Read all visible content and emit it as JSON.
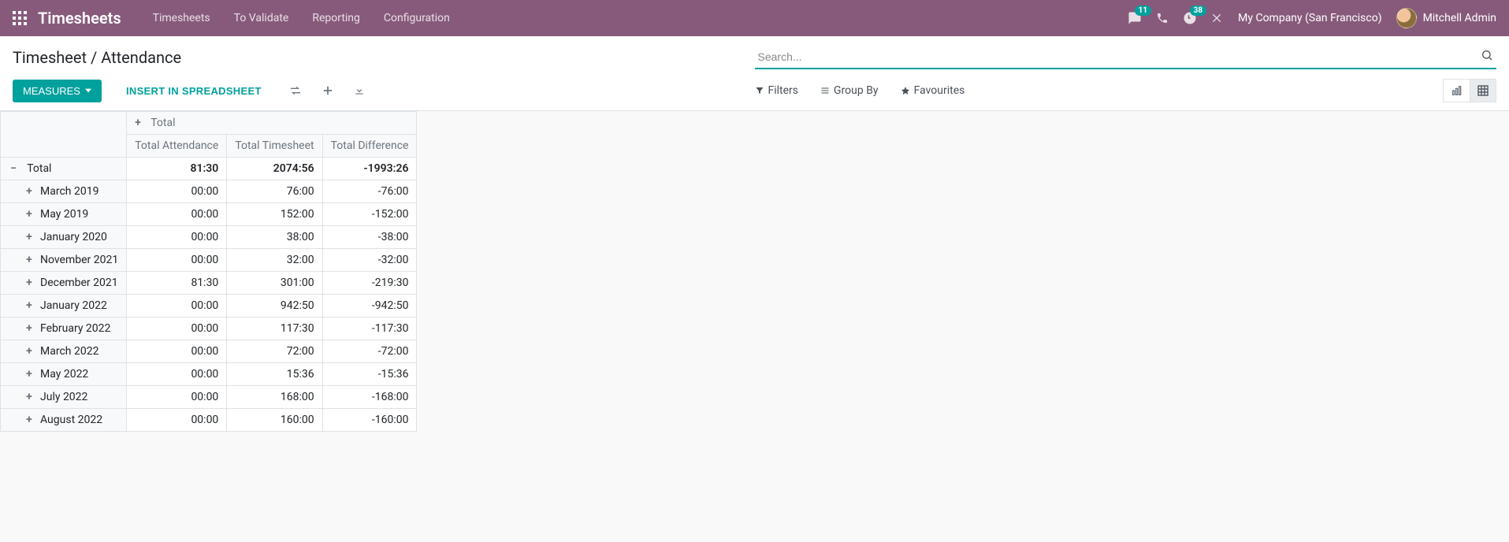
{
  "nav": {
    "brand": "Timesheets",
    "menu": [
      "Timesheets",
      "To Validate",
      "Reporting",
      "Configuration"
    ],
    "messages_badge": "11",
    "activities_badge": "38",
    "company": "My Company (San Francisco)",
    "user": "Mitchell Admin"
  },
  "breadcrumb": "Timesheet / Attendance",
  "search": {
    "placeholder": "Search..."
  },
  "buttons": {
    "measures": "MEASURES",
    "insert_spreadsheet": "INSERT IN SPREADSHEET"
  },
  "search_opts": {
    "filters": "Filters",
    "group_by": "Group By",
    "favourites": "Favourites"
  },
  "pivot": {
    "col_group": "Total",
    "measures": [
      "Total Attendance",
      "Total Timesheet",
      "Total Difference"
    ],
    "total_row": {
      "label": "Total",
      "values": [
        "81:30",
        "2074:56",
        "-1993:26"
      ]
    },
    "rows": [
      {
        "label": "March 2019",
        "values": [
          "00:00",
          "76:00",
          "-76:00"
        ]
      },
      {
        "label": "May 2019",
        "values": [
          "00:00",
          "152:00",
          "-152:00"
        ]
      },
      {
        "label": "January 2020",
        "values": [
          "00:00",
          "38:00",
          "-38:00"
        ]
      },
      {
        "label": "November 2021",
        "values": [
          "00:00",
          "32:00",
          "-32:00"
        ]
      },
      {
        "label": "December 2021",
        "values": [
          "81:30",
          "301:00",
          "-219:30"
        ]
      },
      {
        "label": "January 2022",
        "values": [
          "00:00",
          "942:50",
          "-942:50"
        ]
      },
      {
        "label": "February 2022",
        "values": [
          "00:00",
          "117:30",
          "-117:30"
        ]
      },
      {
        "label": "March 2022",
        "values": [
          "00:00",
          "72:00",
          "-72:00"
        ]
      },
      {
        "label": "May 2022",
        "values": [
          "00:00",
          "15:36",
          "-15:36"
        ]
      },
      {
        "label": "July 2022",
        "values": [
          "00:00",
          "168:00",
          "-168:00"
        ]
      },
      {
        "label": "August 2022",
        "values": [
          "00:00",
          "160:00",
          "-160:00"
        ]
      }
    ]
  }
}
